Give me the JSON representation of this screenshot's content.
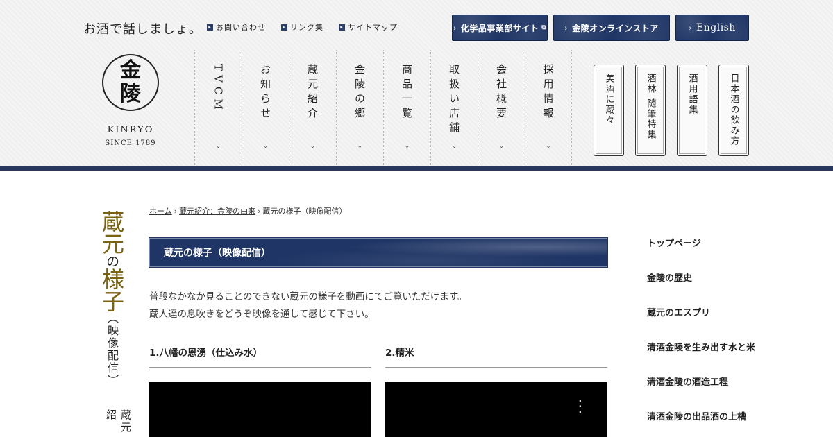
{
  "header": {
    "tagline": "お酒で話しましょ。",
    "util_links": [
      "お問い合わせ",
      "リンク集",
      "サイトマップ"
    ],
    "ext_buttons": {
      "chemical": "化学品事業部サイト",
      "store": "金陵オンラインストア",
      "english": "English"
    },
    "logo": {
      "glyph_top": "金",
      "glyph_bottom": "陵",
      "name": "KINRYO",
      "since": "SINCE 1789"
    },
    "nav": [
      "TVCM",
      "お知らせ",
      "蔵元紹介",
      "金陵の郷",
      "商品一覧",
      "取扱い店舗",
      "会社概要",
      "採用情報"
    ],
    "side_buttons": [
      "美酒に蔵々",
      "酒林 随筆特集",
      "酒用語集",
      "日本酒の飲み方"
    ]
  },
  "page": {
    "vertical_title": {
      "part1": "蔵元",
      "part2": "の",
      "part3": "様子",
      "part4": "（映像配信）"
    },
    "vertical_sub": "蔵元紹",
    "breadcrumb": {
      "home": "ホーム",
      "parent": "蔵元紹介：金陵の由来",
      "current": "蔵元の様子（映像配信）"
    },
    "section_title": "蔵元の様子（映像配信）",
    "intro_line1": "普段なかなか見ることのできない蔵元の様子を動画にてご覧いただけます。",
    "intro_line2": "蔵人達の息吹きをどうぞ映像を通して感じて下さい。",
    "videos": [
      {
        "title": "1.八幡の恩湧（仕込み水）"
      },
      {
        "title": "2.精米"
      }
    ]
  },
  "right_menu": [
    "トップページ",
    "金陵の歴史",
    "蔵元のエスプリ",
    "清酒金陵を生み出す水と米",
    "清酒金陵の酒造工程",
    "清酒金陵の出品酒の上槽"
  ]
}
